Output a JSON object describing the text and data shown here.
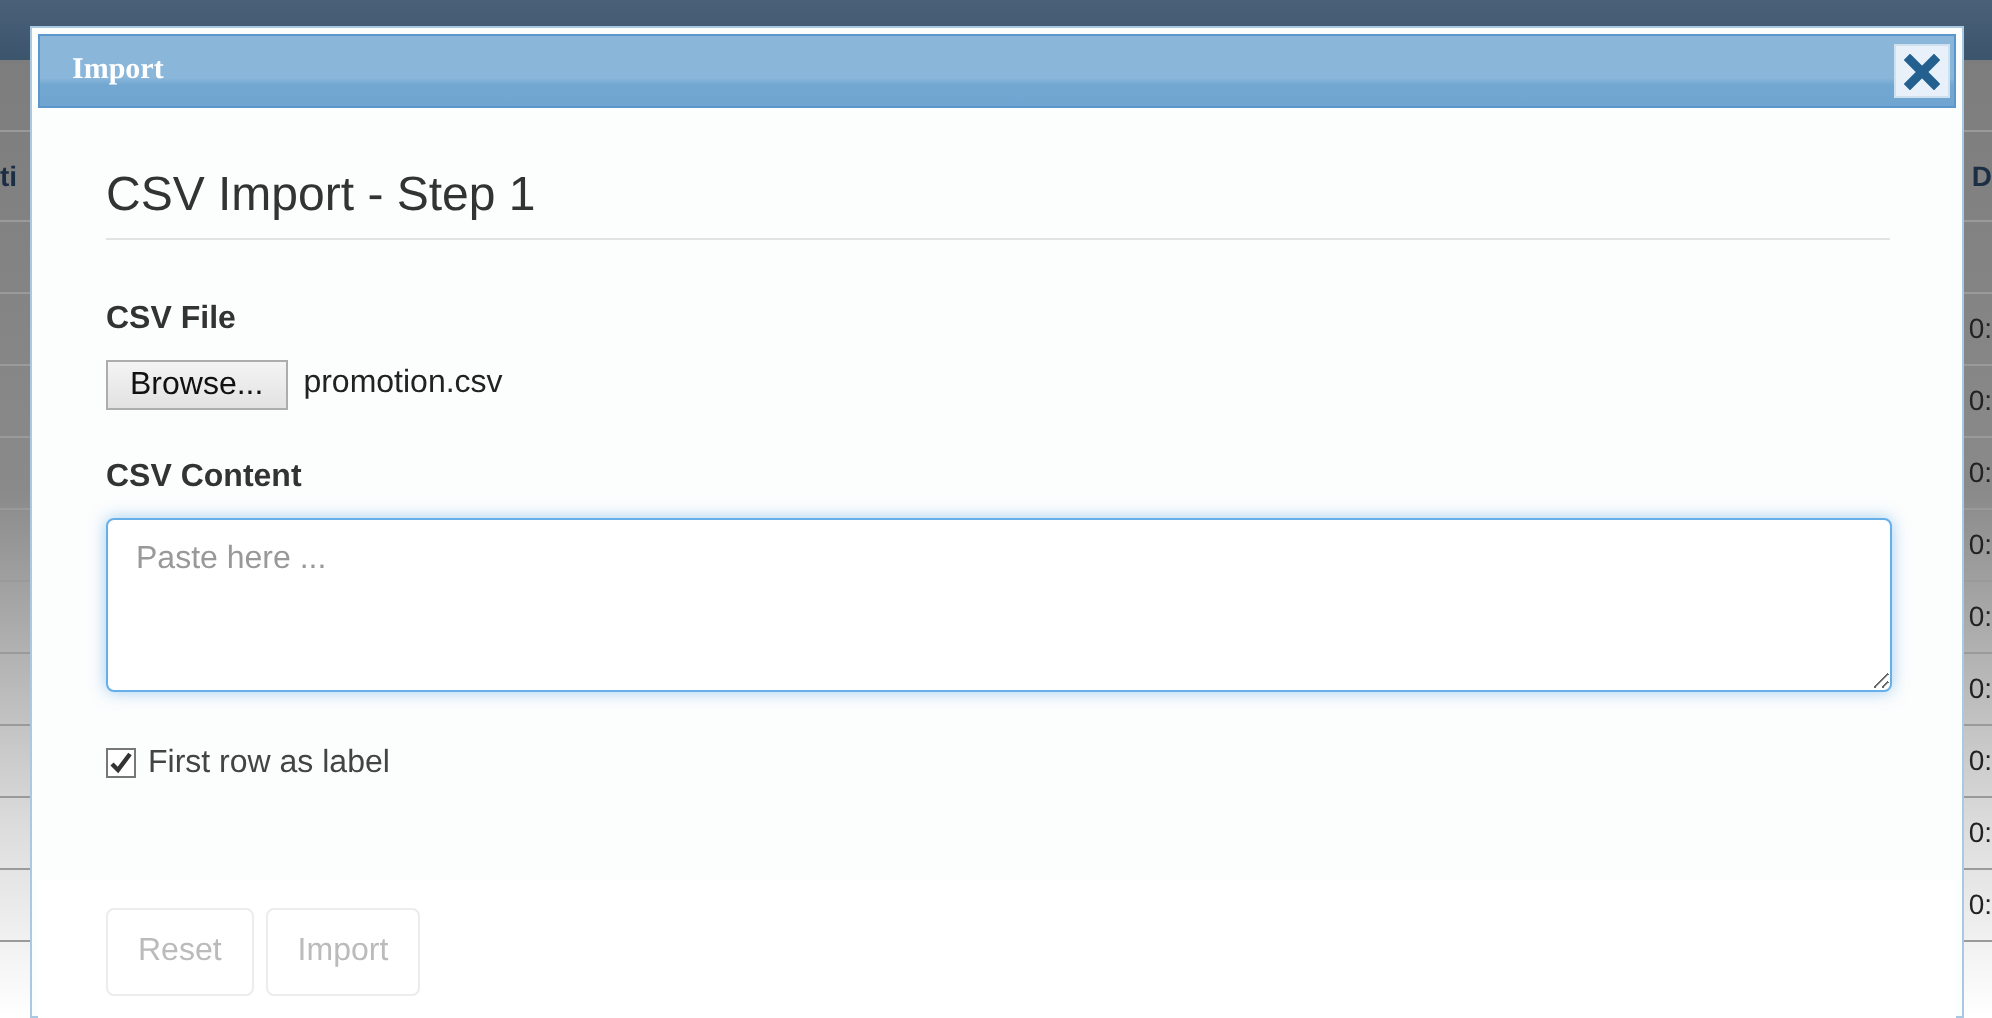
{
  "background_table": {
    "left_header": "ti",
    "right_header": "D",
    "right_cells": [
      "0:",
      "0:",
      "0:",
      "0:",
      "0:",
      "0:",
      "0:",
      "0:",
      "0:"
    ]
  },
  "dialog": {
    "title": "Import",
    "heading": "CSV Import - Step 1",
    "file_label": "CSV File",
    "browse_button": "Browse...",
    "file_name": "promotion.csv",
    "content_label": "CSV Content",
    "content_field": {
      "placeholder": "Paste here ..."
    },
    "first_row_option": {
      "label": "First row as label",
      "checked": true
    },
    "buttons": [
      {
        "label": "Reset",
        "disabled": true
      },
      {
        "label": "Import",
        "disabled": true
      }
    ]
  }
}
